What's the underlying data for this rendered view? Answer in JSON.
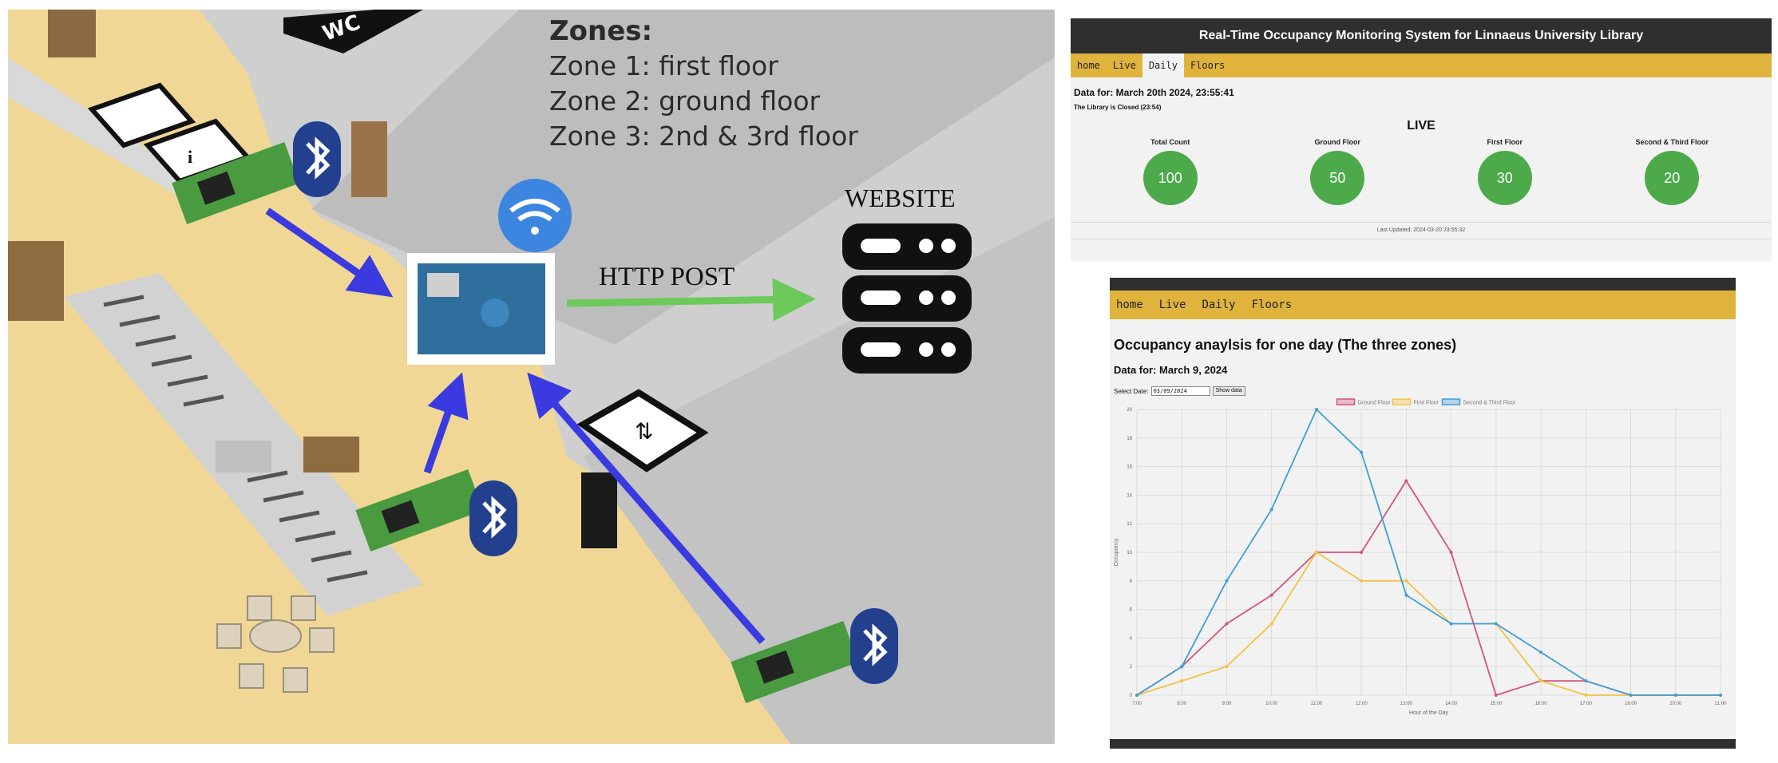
{
  "illustration": {
    "zones_title": "Zones:",
    "zones": [
      "Zone 1: first floor",
      "Zone 2: ground floor",
      "Zone 3: 2nd & 3rd floor"
    ],
    "http_label": "HTTP POST",
    "website_label": "WEBSITE",
    "wc_label": "WC",
    "colors": {
      "floor": "#f0d796",
      "wall": "#c8c8c8",
      "arrow_blue": "#3a3ae0",
      "arrow_green": "#6cc95a",
      "bluetooth": "#23408f",
      "wifi": "#3d86e0"
    }
  },
  "live_panel": {
    "header_title": "Real-Time Occupancy Monitoring System for Linnaeus University Library",
    "nav": [
      "home",
      "Live",
      "Daily",
      "Floors"
    ],
    "active_nav": "Daily",
    "date_line": "Data for: March 20th 2024, 23:55:41",
    "closed_line": "The Library is Closed (23:54)",
    "live_title": "LIVE",
    "counts": [
      {
        "label": "Total Count",
        "value": "100"
      },
      {
        "label": "Ground Floor",
        "value": "50"
      },
      {
        "label": "First Floor",
        "value": "30"
      },
      {
        "label": "Second & Third Floor",
        "value": "20"
      }
    ],
    "last_updated": "Last Updated: 2024-03-20 23:55:32",
    "colors": {
      "header": "#2f2f2f",
      "nav": "#e0b33c",
      "circle": "#4caa4a"
    }
  },
  "daily_panel": {
    "nav": [
      "home",
      "Live",
      "Daily",
      "Floors"
    ],
    "heading": "Occupancy anaylsis for one day (The three zones)",
    "data_date": "Data for: March 9, 2024",
    "select_label": "Select Date:",
    "date_value": "03/09/2024",
    "show_button": "Show data"
  },
  "chart_data": {
    "type": "line",
    "title": "",
    "xlabel": "Hour of the Day",
    "ylabel": "Occupancy",
    "x": [
      "7:00",
      "8:00",
      "9:00",
      "10:00",
      "11:00",
      "12:00",
      "13:00",
      "14:00",
      "15:00",
      "16:00",
      "17:00",
      "18:00",
      "20:00",
      "21:00"
    ],
    "ylim": [
      0,
      20
    ],
    "yticks": [
      0,
      2,
      4,
      6,
      8,
      10,
      12,
      14,
      16,
      18,
      20
    ],
    "grid": true,
    "legend_position": "top-center",
    "series": [
      {
        "name": "Ground Floor",
        "color": "#d6537a",
        "values": [
          0,
          2,
          5,
          7,
          10,
          10,
          15,
          10,
          0,
          1,
          1,
          0,
          0,
          0
        ]
      },
      {
        "name": "First Floor",
        "color": "#f2c244",
        "values": [
          0,
          1,
          2,
          5,
          10,
          8,
          8,
          5,
          5,
          1,
          0,
          0,
          0,
          0
        ]
      },
      {
        "name": "Second & Third Floor",
        "color": "#3f9ed3",
        "values": [
          0,
          2,
          8,
          13,
          20,
          17,
          7,
          5,
          5,
          3,
          1,
          0,
          0,
          0
        ]
      }
    ]
  }
}
